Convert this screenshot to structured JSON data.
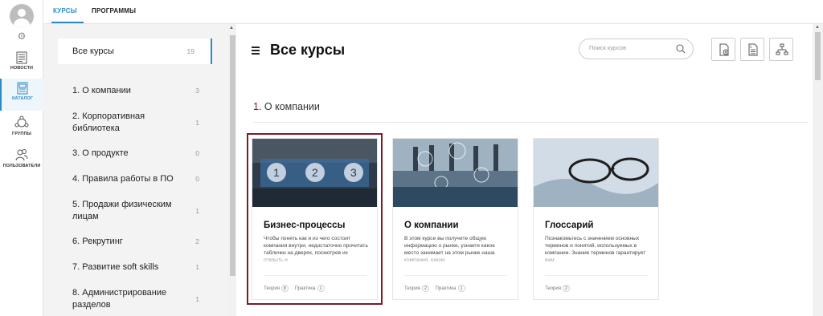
{
  "rail": {
    "items": [
      {
        "label": "НОВОСТИ"
      },
      {
        "label": "КАТАЛОГ"
      },
      {
        "label": "ГРУППЫ"
      },
      {
        "label": "ПОЛЬЗОВАТЕЛИ"
      }
    ],
    "active": "КАТАЛОГ"
  },
  "tabs": [
    {
      "label": "КУРСЫ",
      "active": true
    },
    {
      "label": "ПРОГРАММЫ",
      "active": false
    }
  ],
  "categories": {
    "all": {
      "label": "Все курсы",
      "count": "19"
    },
    "items": [
      {
        "label": "1. О компании",
        "count": "3"
      },
      {
        "label": "2. Корпоративная библиотека",
        "count": "1"
      },
      {
        "label": "3. О продукте",
        "count": "0"
      },
      {
        "label": "4. Правила работы в ПО",
        "count": "0"
      },
      {
        "label": "5. Продажи физическим лицам",
        "count": "1"
      },
      {
        "label": "6. Рекрутинг",
        "count": "2"
      },
      {
        "label": "7. Развитие soft skills",
        "count": "1"
      },
      {
        "label": "8. Администрирование разделов",
        "count": "1"
      }
    ]
  },
  "main": {
    "title": "Все курсы",
    "search_placeholder": "Поиск курсов",
    "section": {
      "number": "1.",
      "name": "О компании"
    },
    "cards": [
      {
        "title": "Бизнес-процессы",
        "description": "Чтобы понять как и из чего состоит компания внутри, недостаточно прочитать таблички на дверях, посмотрев их открыть и",
        "meta": [
          {
            "label": "Теория",
            "count": "8"
          },
          {
            "label": "Практика",
            "count": "1"
          }
        ],
        "selected": true
      },
      {
        "title": "О компании",
        "description": "В этом курсе вы получите общую информацию о рынке, узнаете какое место занимает на этом рынке наша компания, какую",
        "meta": [
          {
            "label": "Теория",
            "count": "2"
          },
          {
            "label": "Практика",
            "count": "1"
          }
        ],
        "selected": false
      },
      {
        "title": "Глоссарий",
        "description": "Познакомьтесь с значением основных терминов и понятий, используемых в компании. Знание терминов гарантирует вам",
        "meta": [
          {
            "label": "Теория",
            "count": "2"
          }
        ],
        "selected": false
      }
    ]
  },
  "colors": {
    "accent": "#2b8ac6",
    "selection": "#7b1b2b",
    "section_number": "#7a1025"
  }
}
